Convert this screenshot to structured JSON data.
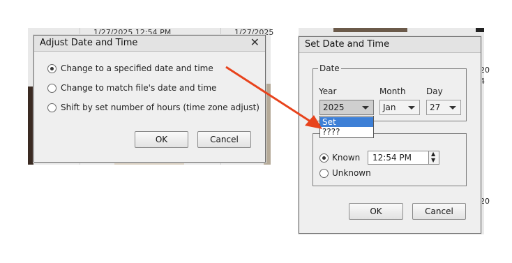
{
  "background": {
    "dates": [
      "1/27/2025 12:54 PM",
      "1/27/2025"
    ],
    "right_edge_glyphs": [
      "20",
      "4",
      "20"
    ]
  },
  "adjust_dialog": {
    "title": "Adjust Date and Time",
    "options": [
      {
        "label": "Change to a specified date and time",
        "selected": true
      },
      {
        "label": "Change to match file's date and time",
        "selected": false
      },
      {
        "label": "Shift by set number of hours (time zone adjust)",
        "selected": false
      }
    ],
    "ok_label": "OK",
    "cancel_label": "Cancel",
    "close_icon": "close-icon"
  },
  "set_dialog": {
    "title": "Set Date and Time",
    "date_group_label": "Date",
    "year": {
      "label": "Year",
      "value": "2025",
      "options": [
        "Set",
        "????"
      ],
      "highlighted": "Set"
    },
    "month": {
      "label": "Month",
      "value": "Jan"
    },
    "day": {
      "label": "Day",
      "value": "27"
    },
    "time_options": [
      {
        "label": "Known",
        "selected": true
      },
      {
        "label": "Unknown",
        "selected": false
      }
    ],
    "time_value": "12:54 PM",
    "ok_label": "OK",
    "cancel_label": "Cancel"
  },
  "colors": {
    "arrow": "#e8431c",
    "highlight": "#3d7fd6",
    "dialog_bg": "#efefef"
  }
}
